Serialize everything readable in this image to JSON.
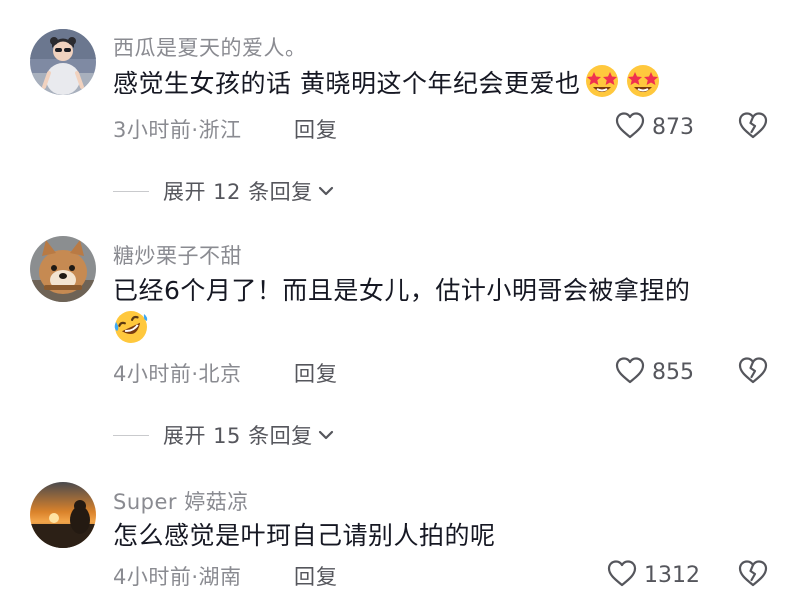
{
  "comments": [
    {
      "username": "西瓜是夏天的爱人。",
      "text": "感觉生女孩的话 黄晓明这个年纪会更爱也",
      "emoji": [
        "star-struck-emoji",
        "star-struck-emoji"
      ],
      "meta": "3小时前·浙江",
      "reply_label": "回复",
      "likes": "873",
      "expand_label": "展开 12 条回复"
    },
    {
      "username": "糖炒栗子不甜",
      "text": "已经6个月了！而且是女儿，估计小明哥会被拿捏的",
      "emoji": [
        "rolling-laughing-emoji"
      ],
      "meta": "4小时前·北京",
      "reply_label": "回复",
      "likes": "855",
      "expand_label": "展开 15 条回复"
    },
    {
      "username": "Super 婷菇凉",
      "text": "怎么感觉是叶珂自己请别人拍的呢",
      "emoji": [],
      "meta": "4小时前·湖南",
      "reply_label": "回复",
      "likes": "1312"
    }
  ],
  "icons": {
    "like": "heart-outline-icon",
    "dislike": "broken-heart-icon",
    "expand": "chevron-down-icon"
  },
  "colors": {
    "text_primary": "#161823",
    "text_secondary": "#8a8b91",
    "text_action": "#55565c",
    "divider": "#c9cacd"
  }
}
